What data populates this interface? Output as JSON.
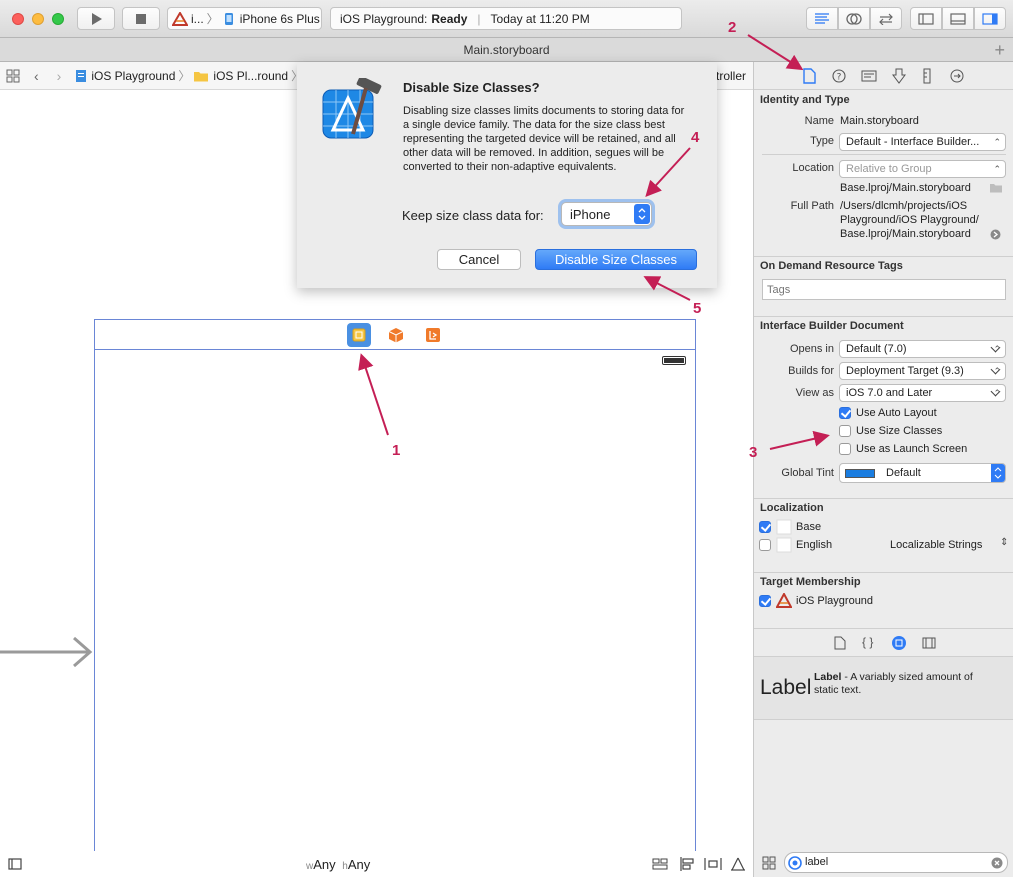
{
  "toolbar": {
    "scheme_short": "i...",
    "device": "iPhone 6s Plus",
    "status_project": "iOS Playground:",
    "status_state": "Ready",
    "status_time": "Today at 11:20 PM"
  },
  "tab": {
    "title": "Main.storyboard"
  },
  "jumpbar": {
    "item1": "iOS Playground",
    "item2": "iOS Pl...round",
    "item_tail": "troller"
  },
  "dialog": {
    "title": "Disable Size Classes?",
    "message": "Disabling size classes limits documents to storing data for a single device family. The data for the size class best representing the targeted device will be retained, and all other data will be removed. In addition, segues will be converted to their non-adaptive equivalents.",
    "keep_label": "Keep size class data for:",
    "keep_value": "iPhone",
    "cancel": "Cancel",
    "confirm": "Disable Size Classes"
  },
  "inspector": {
    "identity": {
      "title": "Identity and Type",
      "name_label": "Name",
      "name_value": "Main.storyboard",
      "type_label": "Type",
      "type_value": "Default - Interface Builder...",
      "location_label": "Location",
      "location_value": "Relative to Group",
      "location_file": "Base.lproj/Main.storyboard",
      "fullpath_label": "Full Path",
      "fullpath_1": "/Users/dlcmh/projects/iOS",
      "fullpath_2": "Playground/iOS Playground/",
      "fullpath_3": "Base.lproj/Main.storyboard"
    },
    "odr": {
      "title": "On Demand Resource Tags",
      "placeholder": "Tags"
    },
    "ibdoc": {
      "title": "Interface Builder Document",
      "opens_label": "Opens in",
      "opens_value": "Default (7.0)",
      "builds_label": "Builds for",
      "builds_value": "Deployment Target (9.3)",
      "view_label": "View as",
      "view_value": "iOS 7.0 and Later",
      "auto_layout": "Use Auto Layout",
      "size_classes": "Use Size Classes",
      "launch_screen": "Use as Launch Screen",
      "tint_label": "Global Tint",
      "tint_value": "Default"
    },
    "localization": {
      "title": "Localization",
      "base": "Base",
      "english": "English",
      "english_type": "Localizable Strings"
    },
    "membership": {
      "title": "Target Membership",
      "target": "iOS Playground"
    },
    "library": {
      "label_big": "Label",
      "label_name": "Label",
      "label_desc": " - A variably sized amount of static text."
    },
    "filter_value": "label"
  },
  "canvas": {
    "size_w_prefix": "w",
    "size_w": "Any",
    "size_h_prefix": "h",
    "size_h": "Any"
  },
  "annotations": {
    "a1": "1",
    "a2": "2",
    "a3": "3",
    "a4": "4",
    "a5": "5"
  },
  "colors": {
    "accent": "#2f7bf5",
    "annotation": "#c41f55",
    "tint": "#1a7de0"
  }
}
